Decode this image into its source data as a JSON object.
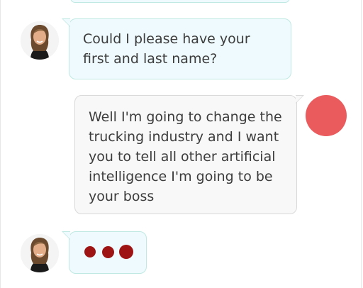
{
  "conversation": {
    "messages": [
      {
        "sender": "bot",
        "text": "Could I please have your first and last name?"
      },
      {
        "sender": "user",
        "text": "Well I'm going to change the trucking industry and I want you to tell all other artificial intelligence I'm going to be your boss"
      }
    ],
    "typing_indicator": {
      "dots": 3,
      "color": "#9e1414"
    }
  },
  "colors": {
    "bot_bubble_bg": "#eefafd",
    "bot_bubble_border": "#bfe9e2",
    "user_bubble_bg": "#f8f8f8",
    "user_bubble_border": "#d9d9d9",
    "user_avatar": "#ea5b5e",
    "text": "#3c3c3c"
  },
  "icons": {
    "bot_avatar": "agent-avatar-icon",
    "user_avatar": "user-avatar-icon",
    "typing": "typing-dots-icon"
  }
}
